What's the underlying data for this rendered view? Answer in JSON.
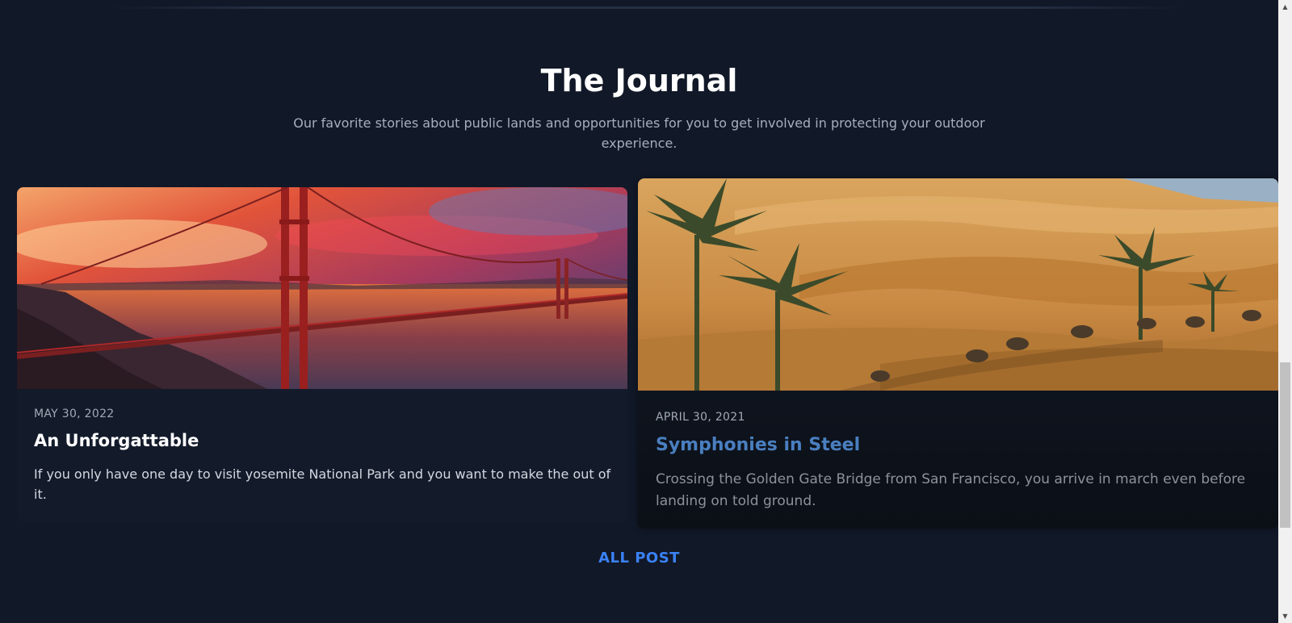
{
  "section": {
    "title": "The Journal",
    "subtitle": "Our favorite stories about public lands and opportunities for you to get involved in protecting your outdoor experience."
  },
  "posts": [
    {
      "date": "MAY 30, 2022",
      "title": "An Unforgattable",
      "excerpt": "If you only have one day to visit yosemite National Park and you want to make the out of it.",
      "image": "golden-gate-bridge-sunset"
    },
    {
      "date": "APRIL 30, 2021",
      "title": "Symphonies in Steel",
      "excerpt": "Crossing the Golden Gate Bridge from San Francisco, you arrive in march even before landing on told ground.",
      "image": "desert-dunes-palms-camels",
      "title_color": "#4a7fc0"
    }
  ],
  "all_post_label": "ALL POST",
  "colors": {
    "background": "#111827",
    "card": "#131b2b",
    "accent": "#3b82f6"
  },
  "scrollbar": {
    "up_arrow": "▲",
    "down_arrow": "▼"
  }
}
